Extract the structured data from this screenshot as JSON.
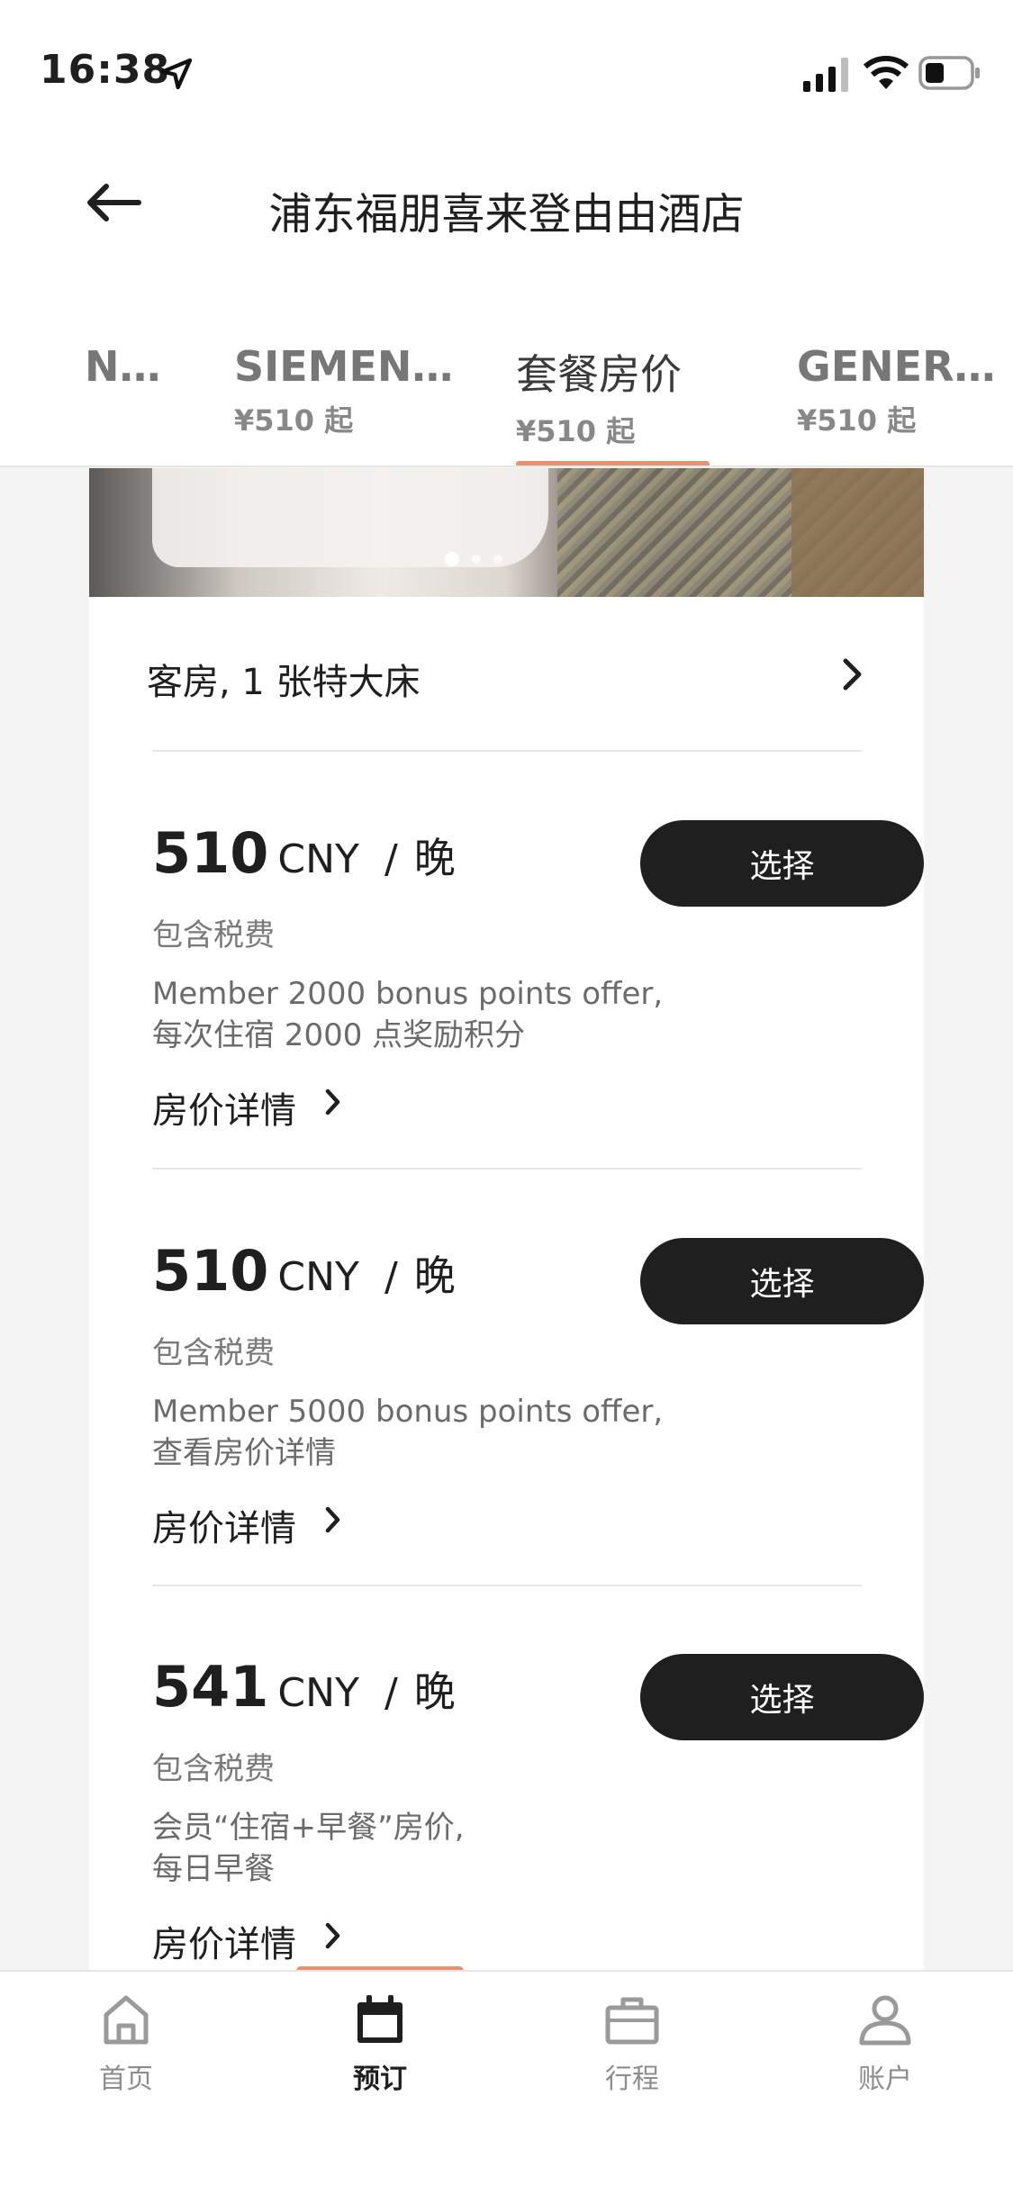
{
  "status_bar": {
    "time": "16:38"
  },
  "header": {
    "title": "浦东福朋喜来登由由酒店"
  },
  "tabs": [
    {
      "label": "N…",
      "price": ""
    },
    {
      "label": "SIEMEN…",
      "price": "¥510 起"
    },
    {
      "label": "套餐房价",
      "price": "¥510 起",
      "active": true
    },
    {
      "label": "GENER…",
      "price": "¥510 起"
    }
  ],
  "room": {
    "name": "客房, 1 张特大床",
    "carousel": {
      "current": 1,
      "total": 3
    }
  },
  "rates": [
    {
      "amount": "510",
      "currency": "CNY",
      "sep": "/",
      "unit": "晚",
      "tax": "包含税费",
      "desc_line1": "Member 2000 bonus points offer,",
      "desc_line2": "每次住宿 2000 点奖励积分",
      "details": "房价详情",
      "select": "选择"
    },
    {
      "amount": "510",
      "currency": "CNY",
      "sep": "/",
      "unit": "晚",
      "tax": "包含税费",
      "desc_line1": "Member 5000 bonus points offer,",
      "desc_line2": "查看房价详情",
      "details": "房价详情",
      "select": "选择"
    },
    {
      "amount": "541",
      "currency": "CNY",
      "sep": "/",
      "unit": "晚",
      "tax": "包含税费",
      "desc_line1": "会员“住宿+早餐”房价,",
      "desc_line2": "每日早餐",
      "details": "房价详情",
      "select": "选择"
    }
  ],
  "bottom_nav": [
    {
      "label": "首页",
      "icon": "home-icon"
    },
    {
      "label": "预订",
      "icon": "calendar-icon",
      "active": true
    },
    {
      "label": "行程",
      "icon": "briefcase-icon"
    },
    {
      "label": "账户",
      "icon": "user-icon"
    }
  ],
  "colors": {
    "accent": "#e9906e",
    "button": "#1f1f1f"
  }
}
